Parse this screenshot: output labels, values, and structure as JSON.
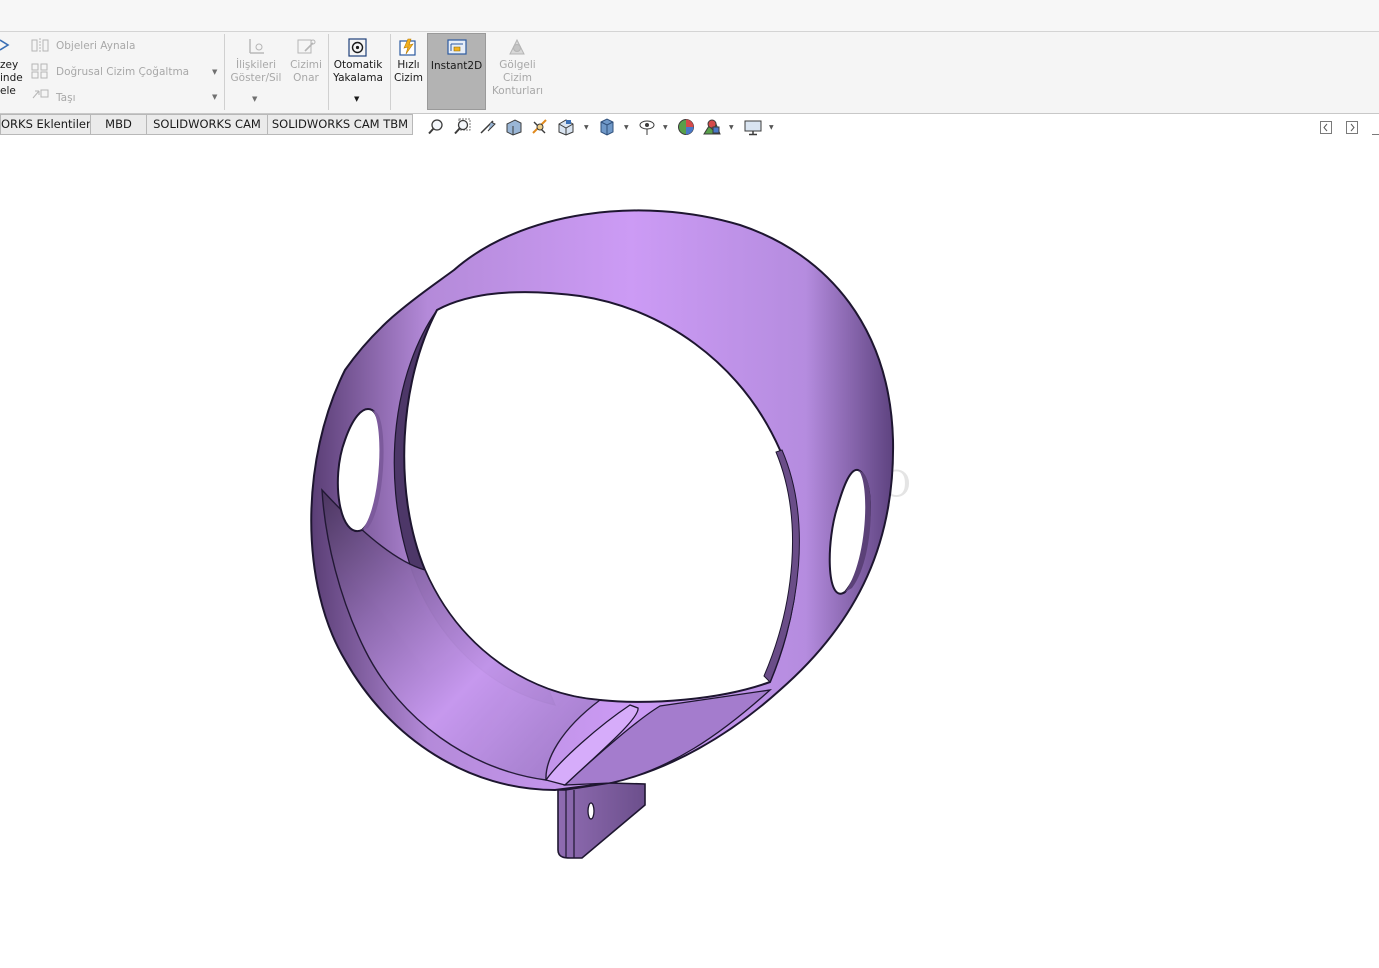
{
  "ribbon": {
    "left_cut_labels": [
      "zey",
      "inde",
      "ele"
    ],
    "mirror_label": "Objeleri Aynala",
    "linear_pattern_label": "Doğrusal Cizim Çoğaltma",
    "move_label": "Taşı",
    "relations_label": [
      "İlişkileri",
      "Göster/Sil"
    ],
    "repair_label": [
      "Cizimi",
      "Onar"
    ],
    "autosnap_label": [
      "Otomatik",
      "Yakalama"
    ],
    "rapid_sketch_label": [
      "Hızlı",
      "Cizim"
    ],
    "instant2d_label": "Instant2D",
    "shaded_contours_label": [
      "Gölgeli",
      "Cizim",
      "Konturları"
    ]
  },
  "tabs": [
    {
      "label": "ORKS Eklentileri"
    },
    {
      "label": "MBD"
    },
    {
      "label": "SOLIDWORKS CAM"
    },
    {
      "label": "SOLIDWORKS CAM TBM"
    }
  ],
  "hud_icons": [
    "zoom-to-fit-icon",
    "zoom-to-area-icon",
    "previous-view-icon",
    "section-view-icon",
    "dynamic-annotation-icon",
    "view-orientation-icon",
    "display-style-icon",
    "hide-show-items-icon",
    "edit-appearance-icon",
    "apply-scene-icon",
    "view-settings-icon"
  ],
  "viewport": {
    "watermark": "OX.CO",
    "part_color": "#c99cf2",
    "edge_color": "#1e1630"
  }
}
